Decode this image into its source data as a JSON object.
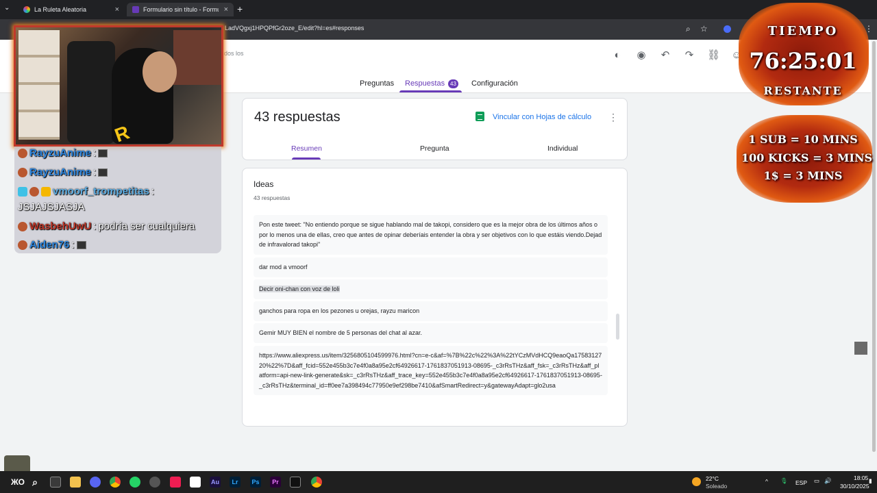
{
  "browser": {
    "tabs": [
      {
        "label": "La Ruleta Aleatoria",
        "active": false
      },
      {
        "label": "Formulario sin título - Formular",
        "active": true
      }
    ],
    "url": "LadVQgxj1HPQPfGr2oze_E/edit?hl=es#responses"
  },
  "form": {
    "header_faint": "dos los",
    "tabs": [
      {
        "label": "Preguntas"
      },
      {
        "label": "Respuestas",
        "badge": "43"
      },
      {
        "label": "Configuración"
      }
    ],
    "summary": {
      "title": "43 respuestas",
      "link_sheets": "Vincular con Hojas de cálculo",
      "subtabs": [
        "Resumen",
        "Pregunta",
        "Individual"
      ]
    },
    "question": {
      "title": "Ideas",
      "count": "43 respuestas",
      "responses": [
        "Pon este tweet: \"No entiendo porque se sigue hablando mal de takopi, considero que es la mejor obra de los últimos años o por lo menos una de ellas, creo que antes de opinar deberíais entender la obra y ser objetivos con lo que estáis viendo.Dejad de infravalorad takopi\"",
        "dar mod a vmoorf",
        "Decir oni-chan con voz de loli",
        "ganchos para ropa en los pezones u orejas, rayzu maricon",
        "Gemir MUY BIEN el nombre de 5 personas del chat al azar.",
        "https://www.aliexpress.us/item/3256805104599976.html?cn=e-c&af=%7B%22c%22%3A%22tYCzMVdHCQ9eaoQa1758312720%22%7D&aff_fcid=552e455b3c7e4f0a8a95e2cf64926617-1761837051913-08695-_c3rRsTHz&aff_fsk=_c3rRsTHz&aff_platform=api-new-link-generate&sk=_c3rRsTHz&aff_trace_key=552e455b3c7e4f0a8a95e2cf64926617-1761837051913-08695-_c3rRsTHz&terminal_id=ff0ee7a398494c77950e9ef298be7410&afSmartRedirect=y&gatewayAdapt=glo2usa"
      ]
    }
  },
  "stream": {
    "chat": [
      {
        "user": "RayzuAnime",
        "sep": ":",
        "msg": ""
      },
      {
        "user": "RayzuAnime",
        "sep": ":",
        "msg": ""
      },
      {
        "user": "vmoorf_trompetitas",
        "sep": ":",
        "msg": ""
      },
      {
        "user": "",
        "sep": "",
        "msg": "JSJAJSJASJA"
      },
      {
        "user": "WasbehUwU",
        "sep": ":",
        "msg": "podría ser cualquiera"
      },
      {
        "user": "Aiden76",
        "sep": ":",
        "msg": ""
      }
    ],
    "timer": {
      "top_label": "TIEMPO",
      "time": "76:25:01",
      "bottom_label": "RESTANTE"
    },
    "rules": [
      "1 SUB = 10 MINS",
      "100 KICKS = 3 MINS",
      "1$ = 3 MINS"
    ]
  },
  "taskbar": {
    "weather_temp": "22°C",
    "weather_text": "Soleado",
    "lang": "ESP",
    "time": "18:05",
    "date": "30/10/2025"
  }
}
